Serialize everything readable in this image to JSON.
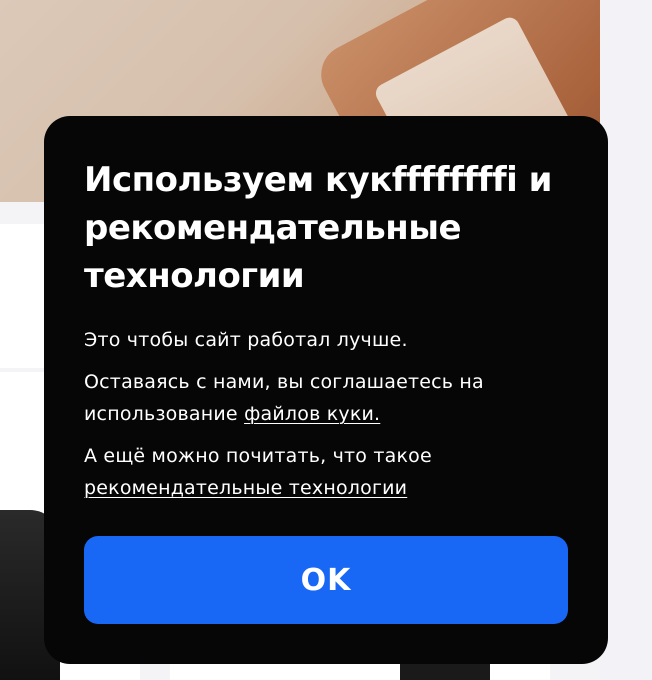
{
  "cookie_dialog": {
    "title": "Используем кукffffffffi и рекомендательные технологии",
    "paragraph_1": "Это чтобы сайт работал лучше.",
    "paragraph_2_prefix": "Оставаясь с нами, вы соглашаетесь на использование ",
    "paragraph_2_link": "файлов куки.",
    "paragraph_3_prefix": "А ещё можно почитать, что такое ",
    "paragraph_3_link": "рекомендательные технологии",
    "ok_label": "OK"
  },
  "colors": {
    "dialog_background": "#060606",
    "button_background": "#1868f5",
    "text": "#ffffff"
  }
}
